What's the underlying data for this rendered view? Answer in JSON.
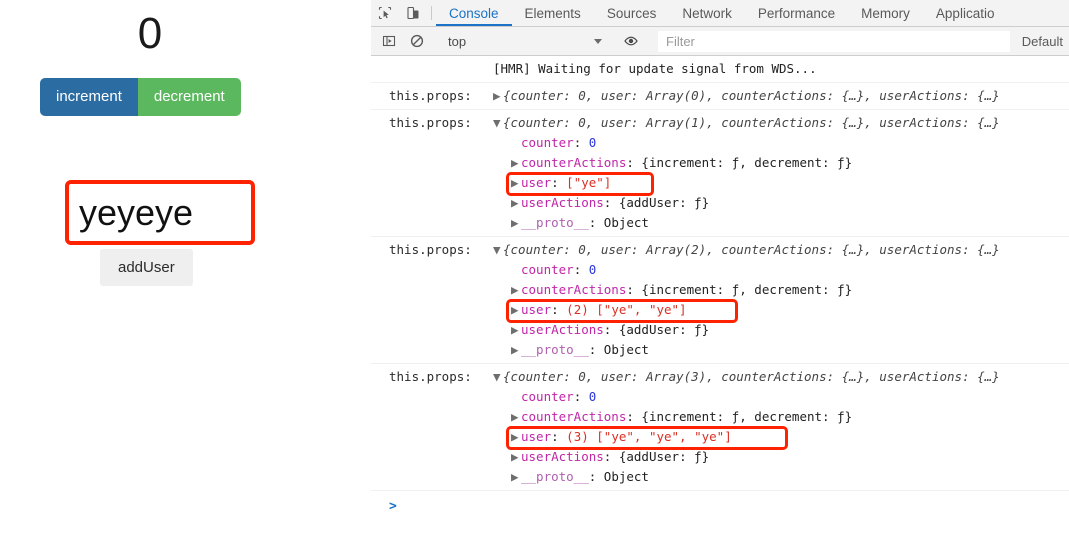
{
  "app": {
    "counter_value": "0",
    "increment_label": "increment",
    "decrement_label": "decrement",
    "user_input_value": "yeyeye",
    "add_user_label": "addUser",
    "colors": {
      "increment_bg": "#2b6ca3",
      "decrement_bg": "#5cb85f",
      "add_user_bg": "#efefef",
      "annotation": "#ff2200"
    }
  },
  "devtools": {
    "toolbar_icons": [
      "inspect-element-icon",
      "device-toolbar-icon"
    ],
    "tabs": [
      {
        "label": "Console",
        "active": true
      },
      {
        "label": "Elements",
        "active": false
      },
      {
        "label": "Sources",
        "active": false
      },
      {
        "label": "Network",
        "active": false
      },
      {
        "label": "Performance",
        "active": false
      },
      {
        "label": "Memory",
        "active": false
      },
      {
        "label": "Applicatio",
        "active": false
      }
    ],
    "filterbar": {
      "sidebar_toggle_icon": "console-sidebar-icon",
      "clear_icon": "clear-console-icon",
      "context_value": "top",
      "eye_icon": "live-expression-icon",
      "filter_placeholder": "Filter",
      "level_value": "Default"
    },
    "prompt_symbol": ">",
    "accent_color": "#1a73c7"
  },
  "console_log": {
    "entries": [
      {
        "id": "hmr",
        "label": "",
        "summary_prefix": "",
        "text": "[HMR] Waiting for update signal from WDS..."
      },
      {
        "id": "props-0",
        "label": "this.props:",
        "disclosure": "collapsed",
        "summary": "{counter: 0, user: Array(0), counterActions: {…}, userActions: {…}"
      },
      {
        "id": "props-1",
        "label": "this.props:",
        "disclosure": "expanded",
        "summary": "{counter: 0, user: Array(1), counterActions: {…}, userActions: {…}",
        "rows": [
          {
            "key": "counter",
            "sep": ": ",
            "value": "0",
            "kind": "num",
            "arrow": false
          },
          {
            "key": "counterActions",
            "sep": ": ",
            "value": "{increment: ƒ, decrement: ƒ}",
            "kind": "plain",
            "arrow": true
          },
          {
            "key": "user",
            "sep": ": ",
            "value": "[\"ye\"]",
            "kind": "array",
            "count": "",
            "items": [
              "ye"
            ],
            "arrow": true,
            "highlight": true
          },
          {
            "key": "userActions",
            "sep": ": ",
            "value": "{addUser: ƒ}",
            "kind": "plain",
            "arrow": true
          },
          {
            "key": "__proto__",
            "sep": ": ",
            "value": "Object",
            "kind": "plain",
            "arrow": true
          }
        ]
      },
      {
        "id": "props-2",
        "label": "this.props:",
        "disclosure": "expanded",
        "summary": "{counter: 0, user: Array(2), counterActions: {…}, userActions: {…}",
        "rows": [
          {
            "key": "counter",
            "sep": ": ",
            "value": "0",
            "kind": "num",
            "arrow": false
          },
          {
            "key": "counterActions",
            "sep": ": ",
            "value": "{increment: ƒ, decrement: ƒ}",
            "kind": "plain",
            "arrow": true
          },
          {
            "key": "user",
            "sep": ": ",
            "value": "(2) [\"ye\", \"ye\"]",
            "kind": "array",
            "count": "(2)",
            "items": [
              "ye",
              "ye"
            ],
            "arrow": true,
            "highlight": true
          },
          {
            "key": "userActions",
            "sep": ": ",
            "value": "{addUser: ƒ}",
            "kind": "plain",
            "arrow": true
          },
          {
            "key": "__proto__",
            "sep": ": ",
            "value": "Object",
            "kind": "plain",
            "arrow": true
          }
        ]
      },
      {
        "id": "props-3",
        "label": "this.props:",
        "disclosure": "expanded",
        "summary": "{counter: 0, user: Array(3), counterActions: {…}, userActions: {…}",
        "rows": [
          {
            "key": "counter",
            "sep": ": ",
            "value": "0",
            "kind": "num",
            "arrow": false
          },
          {
            "key": "counterActions",
            "sep": ": ",
            "value": "{increment: ƒ, decrement: ƒ}",
            "kind": "plain",
            "arrow": true
          },
          {
            "key": "user",
            "sep": ": ",
            "value": "(3) [\"ye\", \"ye\", \"ye\"]",
            "kind": "array",
            "count": "(3)",
            "items": [
              "ye",
              "ye",
              "ye"
            ],
            "arrow": true,
            "highlight": true
          },
          {
            "key": "userActions",
            "sep": ": ",
            "value": "{addUser: ƒ}",
            "kind": "plain",
            "arrow": true
          },
          {
            "key": "__proto__",
            "sep": ": ",
            "value": "Object",
            "kind": "plain",
            "arrow": true
          }
        ]
      }
    ]
  }
}
